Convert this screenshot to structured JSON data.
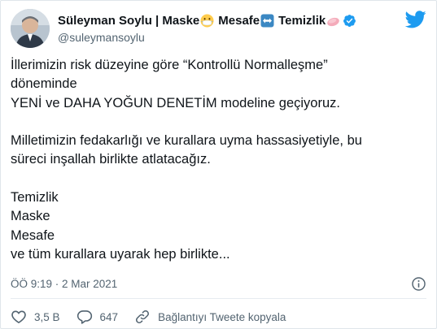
{
  "author": {
    "name": "Süleyman Soylu | Maske",
    "sep_mesafe": "Mesafe",
    "sep_temizlik": "Temizlik",
    "handle": "@suleymansoylu"
  },
  "tweet": {
    "lines": [
      "İllerimizin risk düzeyine göre “Kontrollü Normalleşme”",
      "döneminde",
      "YENİ ve DAHA YOĞUN DENETİM modeline geçiyoruz.",
      "",
      "Milletimizin fedakarlığı ve kurallara uyma hassasiyetiyle, bu",
      "süreci inşallah birlikte atlatacağız.",
      "",
      "Temizlik",
      "Maske",
      "Mesafe",
      "ve tüm kurallara uyarak hep birlikte..."
    ],
    "timestamp": "ÖÖ 9:19 · 2 Mar 2021"
  },
  "actions": {
    "likes": "3,5 B",
    "replies": "647",
    "copy_link": "Bağlantıyı Tweete kopyala"
  },
  "colors": {
    "twitter_blue": "#1d9bf0",
    "text": "#0f1419",
    "muted": "#536471",
    "like_red": "#e0245e"
  },
  "icons": {
    "mask": "mask-emoji-icon",
    "arrows": "left-right-arrow-emoji-icon",
    "soap": "soap-emoji-icon",
    "verified": "verified-badge-icon",
    "bird": "twitter-bird-icon",
    "info": "info-icon",
    "heart": "heart-icon",
    "reply": "reply-icon",
    "link": "link-icon"
  }
}
